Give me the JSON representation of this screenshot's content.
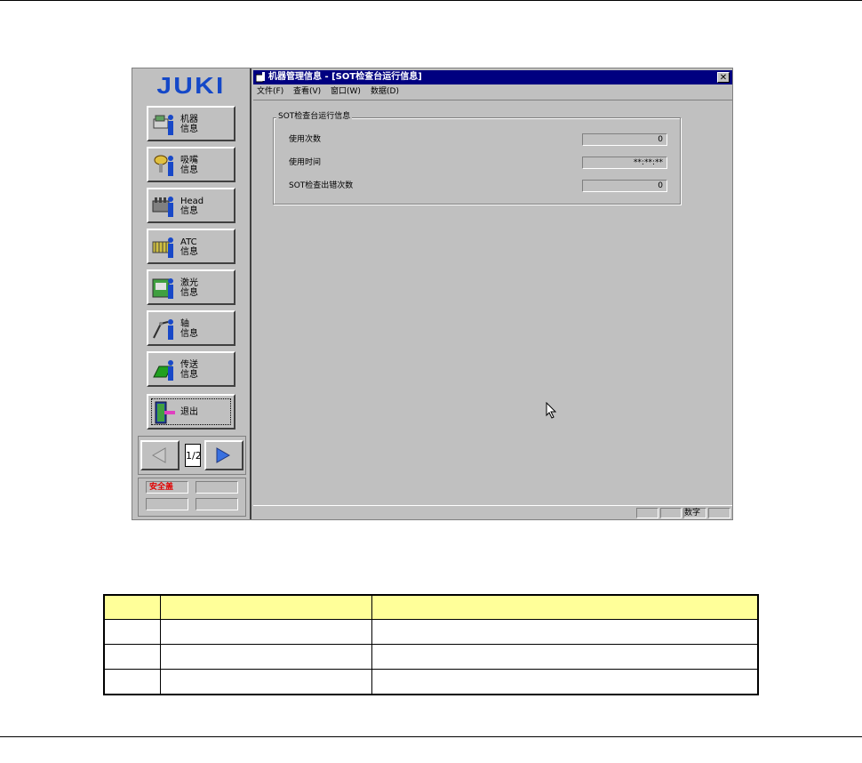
{
  "logo": "JUKI",
  "nav": {
    "buttons": [
      {
        "label": "机器\n信息",
        "icon": "machine-info-icon"
      },
      {
        "label": "吸嘴\n信息",
        "icon": "nozzle-info-icon"
      },
      {
        "label": "Head\n信息",
        "icon": "head-info-icon"
      },
      {
        "label": "ATC\n信息",
        "icon": "atc-info-icon"
      },
      {
        "label": "激光\n信息",
        "icon": "laser-info-icon"
      },
      {
        "label": "轴\n信息",
        "icon": "axis-info-icon"
      },
      {
        "label": "传送\n信息",
        "icon": "conveyor-info-icon"
      },
      {
        "label": "退出",
        "icon": "exit-door-icon"
      }
    ],
    "page_indicator": "1/2"
  },
  "status_panel": {
    "safety_label": "安全盖",
    "safety_color": "#e00000"
  },
  "window": {
    "title": "机器管理信息 - [SOT检查台运行信息]",
    "close_glyph": "✕",
    "menu": {
      "file": "文件(F)",
      "view": "查看(V)",
      "window": "窗口(W)",
      "data": "数据(D)"
    },
    "group_title": "SOT检查台运行信息",
    "fields": [
      {
        "label": "使用次数",
        "value": "0"
      },
      {
        "label": "使用时间",
        "value": "**:**:**"
      },
      {
        "label": "SOT检查出错次数",
        "value": "0"
      }
    ],
    "statusbar": {
      "num": "数字"
    },
    "titlebar_color": "#000080"
  },
  "table": {
    "header_color": "#ffff99",
    "header": [
      "",
      "",
      ""
    ],
    "rows": [
      [
        "",
        "",
        ""
      ],
      [
        "",
        "",
        ""
      ],
      [
        "",
        "",
        ""
      ]
    ]
  }
}
